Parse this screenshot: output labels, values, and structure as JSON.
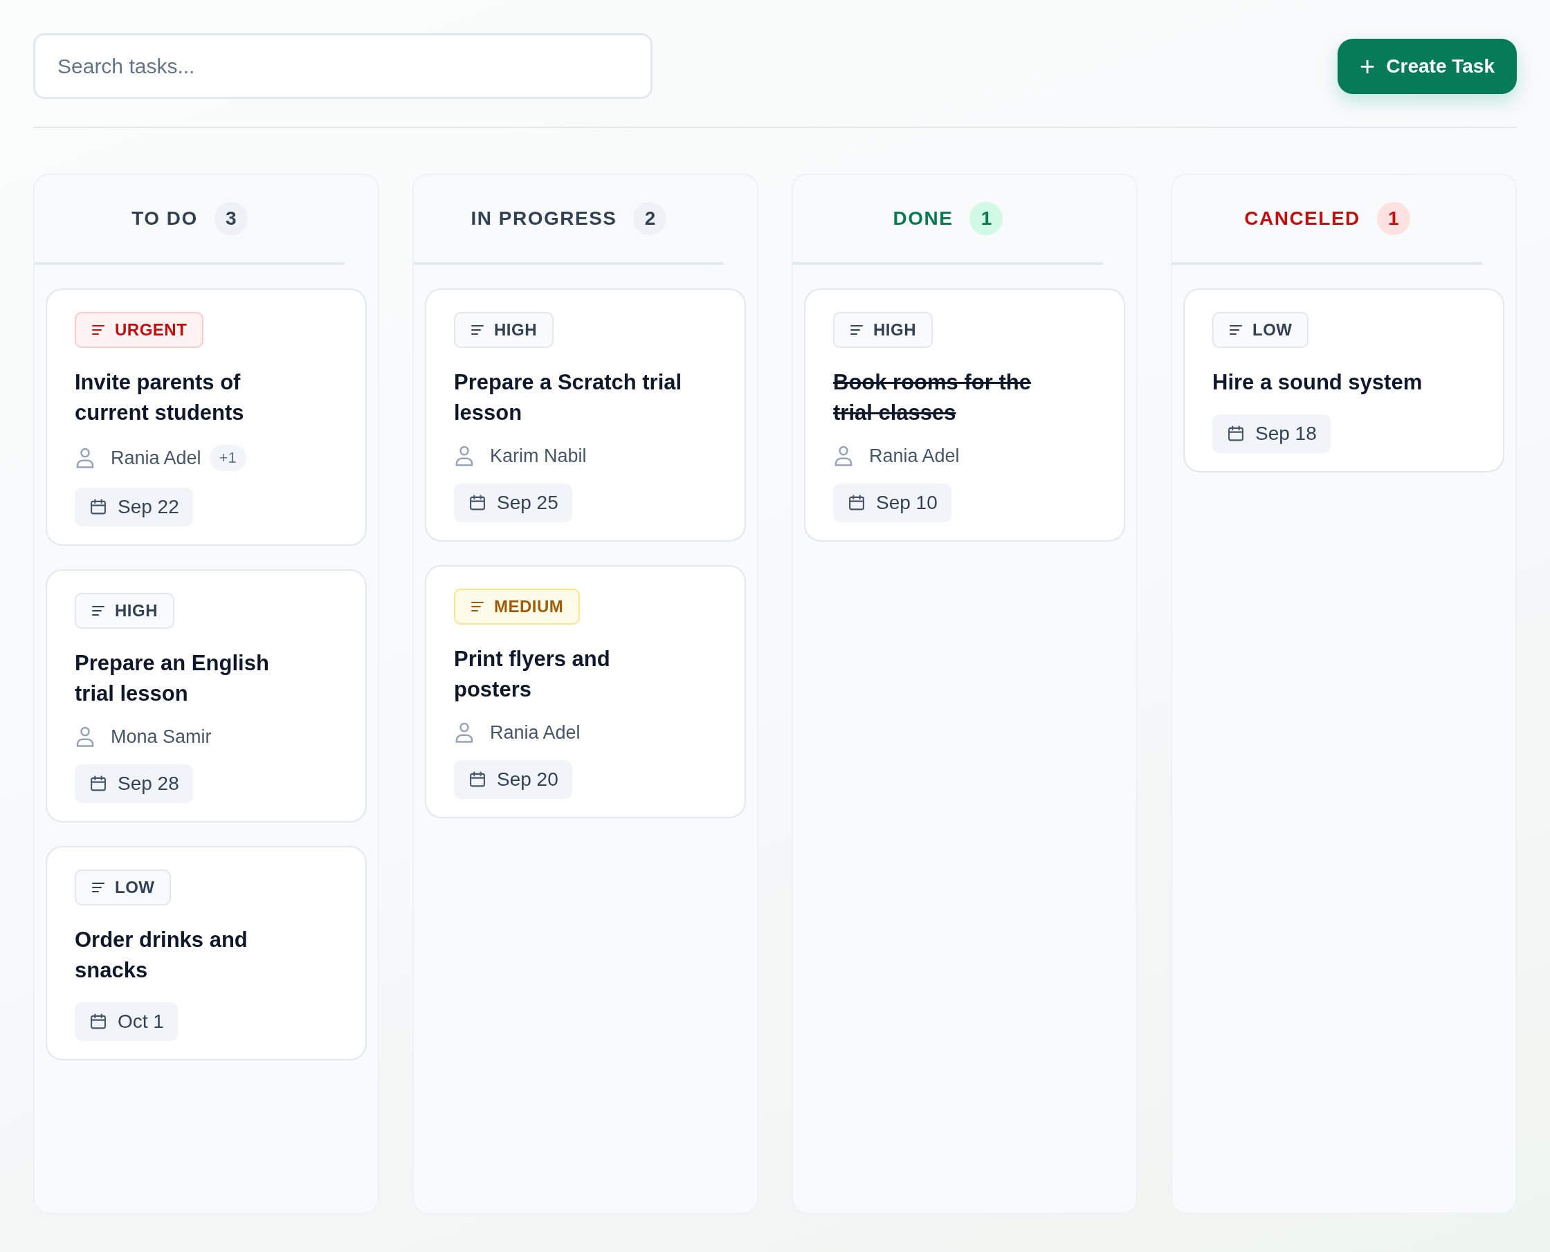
{
  "search": {
    "placeholder": "Search tasks..."
  },
  "create_button": {
    "icon": "+",
    "label": "Create Task"
  },
  "columns": [
    {
      "title": "TO DO",
      "count": "3",
      "kind": "neutral",
      "cards": [
        {
          "priority": {
            "label": "URGENT",
            "kind": "urgent"
          },
          "title": "Invite parents of current students",
          "completed": false,
          "assignee": "Rania Adel",
          "extra": "+1",
          "date": "Sep 22"
        },
        {
          "priority": {
            "label": "HIGH",
            "kind": "high"
          },
          "title": "Prepare an English trial lesson",
          "completed": false,
          "assignee": "Mona Samir",
          "date": "Sep 28"
        },
        {
          "priority": {
            "label": "LOW",
            "kind": "low"
          },
          "title": "Order drinks and snacks",
          "completed": false,
          "date": "Oct 1"
        }
      ]
    },
    {
      "title": "IN PROGRESS",
      "count": "2",
      "kind": "neutral",
      "cards": [
        {
          "priority": {
            "label": "HIGH",
            "kind": "high"
          },
          "title": "Prepare a Scratch trial lesson",
          "completed": false,
          "assignee": "Karim Nabil",
          "date": "Sep 25"
        },
        {
          "priority": {
            "label": "MEDIUM",
            "kind": "medium"
          },
          "title": "Print flyers and posters",
          "completed": false,
          "assignee": "Rania Adel",
          "date": "Sep 20"
        }
      ]
    },
    {
      "title": "DONE",
      "count": "1",
      "kind": "success",
      "cards": [
        {
          "priority": {
            "label": "HIGH",
            "kind": "high"
          },
          "title": "Book rooms for the trial classes",
          "completed": true,
          "assignee": "Rania Adel",
          "date": "Sep 10"
        }
      ]
    },
    {
      "title": "CANCELED",
      "count": "1",
      "kind": "danger",
      "cards": [
        {
          "priority": {
            "label": "LOW",
            "kind": "low"
          },
          "title": "Hire a sound system",
          "completed": false,
          "date": "Sep 18"
        }
      ]
    }
  ]
}
